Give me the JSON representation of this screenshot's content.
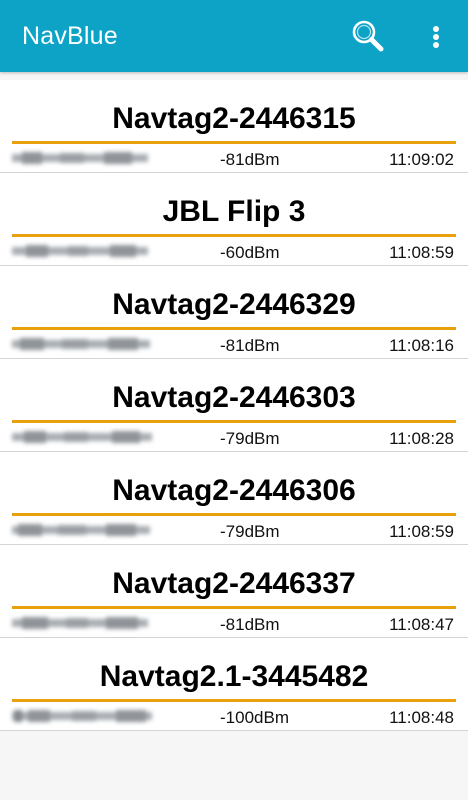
{
  "app_bar": {
    "title": "NavBlue",
    "background_color": "#0ca3c7",
    "search_icon": "search-icon",
    "menu_icon": "more-vert-icon"
  },
  "accent_color": "#e8a10c",
  "devices": [
    {
      "name": "Navtag2-2446315",
      "rssi": "-81dBm",
      "time": "11:09:02"
    },
    {
      "name": "JBL Flip 3",
      "rssi": "-60dBm",
      "time": "11:08:59"
    },
    {
      "name": "Navtag2-2446329",
      "rssi": "-81dBm",
      "time": "11:08:16"
    },
    {
      "name": "Navtag2-2446303",
      "rssi": "-79dBm",
      "time": "11:08:28"
    },
    {
      "name": "Navtag2-2446306",
      "rssi": "-79dBm",
      "time": "11:08:59"
    },
    {
      "name": "Navtag2-2446337",
      "rssi": "-81dBm",
      "time": "11:08:47"
    },
    {
      "name": "Navtag2.1-3445482",
      "rssi": "-100dBm",
      "time": "11:08:48"
    }
  ]
}
